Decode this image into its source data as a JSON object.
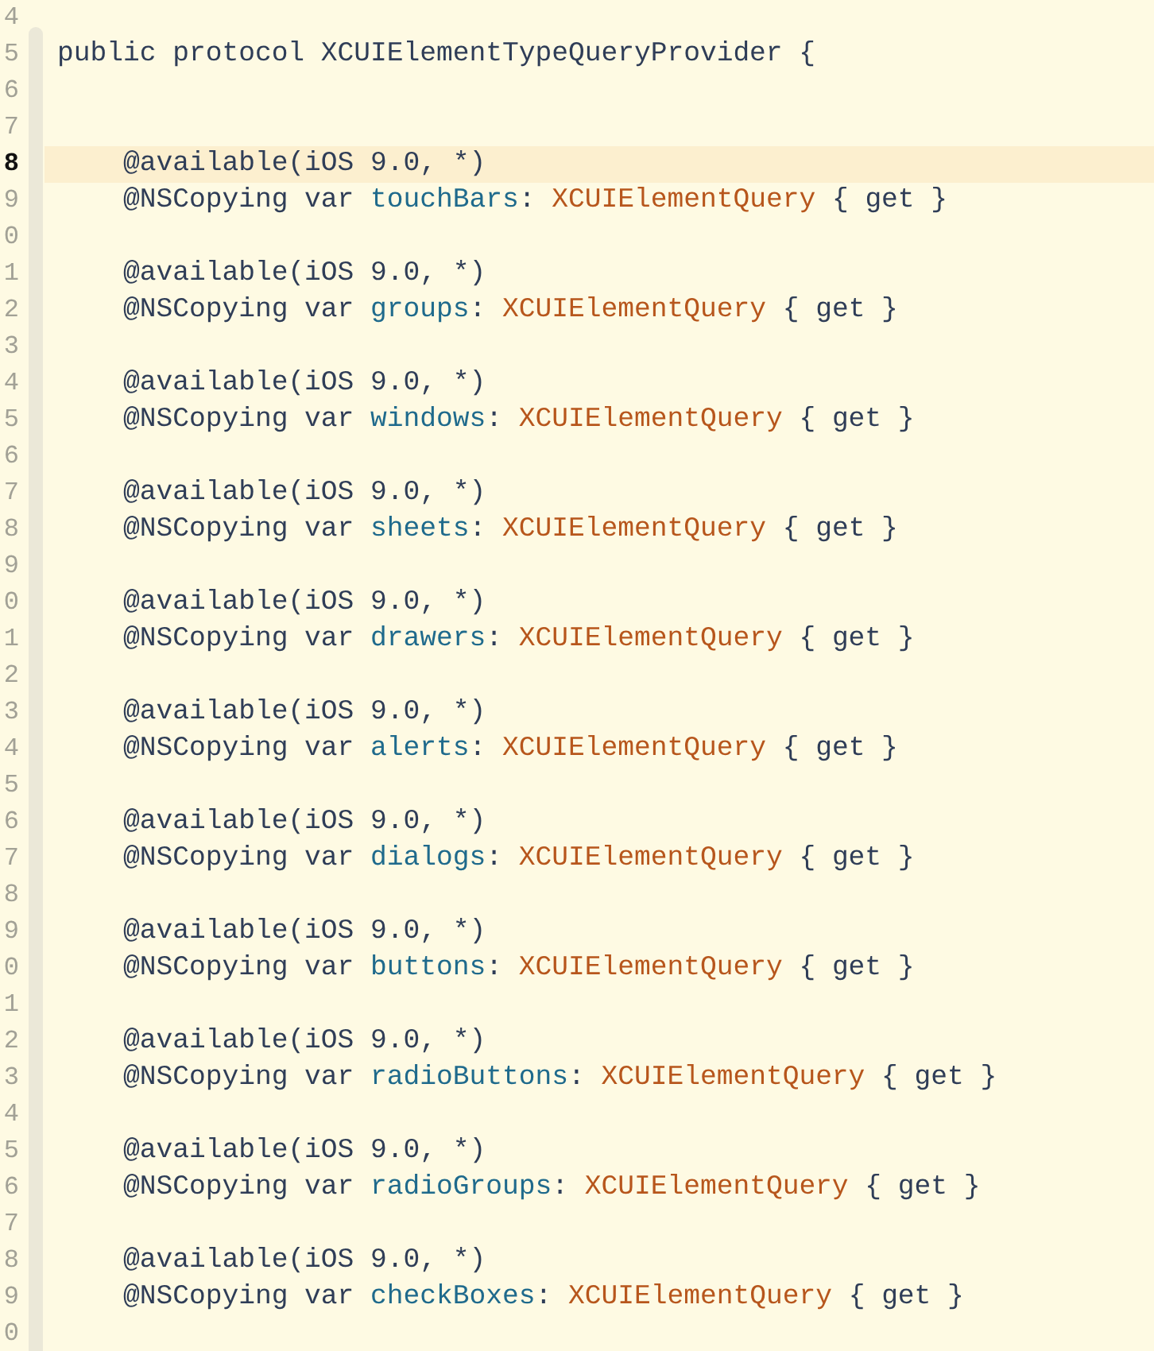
{
  "editor": {
    "lines": [
      {
        "number": "4",
        "highlighted": false
      },
      {
        "number": "5",
        "highlighted": false,
        "tokens": [
          {
            "kind": "plain",
            "text": "public protocol XCUIElementTypeQueryProvider {"
          }
        ]
      },
      {
        "number": "6",
        "highlighted": false
      },
      {
        "number": "7",
        "highlighted": false
      },
      {
        "number": "8",
        "highlighted": true,
        "tokens": [
          {
            "kind": "plain",
            "text": "    @available(iOS 9.0, *)"
          }
        ]
      },
      {
        "number": "9",
        "highlighted": false,
        "tokens": [
          {
            "kind": "plain",
            "text": "    @NSCopying var "
          },
          {
            "kind": "name",
            "text": "touchBars"
          },
          {
            "kind": "plain",
            "text": ": "
          },
          {
            "kind": "type",
            "text": "XCUIElementQuery"
          },
          {
            "kind": "plain",
            "text": " { get }"
          }
        ]
      },
      {
        "number": "0",
        "highlighted": false
      },
      {
        "number": "1",
        "highlighted": false,
        "tokens": [
          {
            "kind": "plain",
            "text": "    @available(iOS 9.0, *)"
          }
        ]
      },
      {
        "number": "2",
        "highlighted": false,
        "tokens": [
          {
            "kind": "plain",
            "text": "    @NSCopying var "
          },
          {
            "kind": "name",
            "text": "groups"
          },
          {
            "kind": "plain",
            "text": ": "
          },
          {
            "kind": "type",
            "text": "XCUIElementQuery"
          },
          {
            "kind": "plain",
            "text": " { get }"
          }
        ]
      },
      {
        "number": "3",
        "highlighted": false
      },
      {
        "number": "4",
        "highlighted": false,
        "tokens": [
          {
            "kind": "plain",
            "text": "    @available(iOS 9.0, *)"
          }
        ]
      },
      {
        "number": "5",
        "highlighted": false,
        "tokens": [
          {
            "kind": "plain",
            "text": "    @NSCopying var "
          },
          {
            "kind": "name",
            "text": "windows"
          },
          {
            "kind": "plain",
            "text": ": "
          },
          {
            "kind": "type",
            "text": "XCUIElementQuery"
          },
          {
            "kind": "plain",
            "text": " { get }"
          }
        ]
      },
      {
        "number": "6",
        "highlighted": false
      },
      {
        "number": "7",
        "highlighted": false,
        "tokens": [
          {
            "kind": "plain",
            "text": "    @available(iOS 9.0, *)"
          }
        ]
      },
      {
        "number": "8",
        "highlighted": false,
        "tokens": [
          {
            "kind": "plain",
            "text": "    @NSCopying var "
          },
          {
            "kind": "name",
            "text": "sheets"
          },
          {
            "kind": "plain",
            "text": ": "
          },
          {
            "kind": "type",
            "text": "XCUIElementQuery"
          },
          {
            "kind": "plain",
            "text": " { get }"
          }
        ]
      },
      {
        "number": "9",
        "highlighted": false
      },
      {
        "number": "0",
        "highlighted": false,
        "tokens": [
          {
            "kind": "plain",
            "text": "    @available(iOS 9.0, *)"
          }
        ]
      },
      {
        "number": "1",
        "highlighted": false,
        "tokens": [
          {
            "kind": "plain",
            "text": "    @NSCopying var "
          },
          {
            "kind": "name",
            "text": "drawers"
          },
          {
            "kind": "plain",
            "text": ": "
          },
          {
            "kind": "type",
            "text": "XCUIElementQuery"
          },
          {
            "kind": "plain",
            "text": " { get }"
          }
        ]
      },
      {
        "number": "2",
        "highlighted": false
      },
      {
        "number": "3",
        "highlighted": false,
        "tokens": [
          {
            "kind": "plain",
            "text": "    @available(iOS 9.0, *)"
          }
        ]
      },
      {
        "number": "4",
        "highlighted": false,
        "tokens": [
          {
            "kind": "plain",
            "text": "    @NSCopying var "
          },
          {
            "kind": "name",
            "text": "alerts"
          },
          {
            "kind": "plain",
            "text": ": "
          },
          {
            "kind": "type",
            "text": "XCUIElementQuery"
          },
          {
            "kind": "plain",
            "text": " { get }"
          }
        ]
      },
      {
        "number": "5",
        "highlighted": false
      },
      {
        "number": "6",
        "highlighted": false,
        "tokens": [
          {
            "kind": "plain",
            "text": "    @available(iOS 9.0, *)"
          }
        ]
      },
      {
        "number": "7",
        "highlighted": false,
        "tokens": [
          {
            "kind": "plain",
            "text": "    @NSCopying var "
          },
          {
            "kind": "name",
            "text": "dialogs"
          },
          {
            "kind": "plain",
            "text": ": "
          },
          {
            "kind": "type",
            "text": "XCUIElementQuery"
          },
          {
            "kind": "plain",
            "text": " { get }"
          }
        ]
      },
      {
        "number": "8",
        "highlighted": false
      },
      {
        "number": "9",
        "highlighted": false,
        "tokens": [
          {
            "kind": "plain",
            "text": "    @available(iOS 9.0, *)"
          }
        ]
      },
      {
        "number": "0",
        "highlighted": false,
        "tokens": [
          {
            "kind": "plain",
            "text": "    @NSCopying var "
          },
          {
            "kind": "name",
            "text": "buttons"
          },
          {
            "kind": "plain",
            "text": ": "
          },
          {
            "kind": "type",
            "text": "XCUIElementQuery"
          },
          {
            "kind": "plain",
            "text": " { get }"
          }
        ]
      },
      {
        "number": "1",
        "highlighted": false
      },
      {
        "number": "2",
        "highlighted": false,
        "tokens": [
          {
            "kind": "plain",
            "text": "    @available(iOS 9.0, *)"
          }
        ]
      },
      {
        "number": "3",
        "highlighted": false,
        "tokens": [
          {
            "kind": "plain",
            "text": "    @NSCopying var "
          },
          {
            "kind": "name",
            "text": "radioButtons"
          },
          {
            "kind": "plain",
            "text": ": "
          },
          {
            "kind": "type",
            "text": "XCUIElementQuery"
          },
          {
            "kind": "plain",
            "text": " { get }"
          }
        ]
      },
      {
        "number": "4",
        "highlighted": false
      },
      {
        "number": "5",
        "highlighted": false,
        "tokens": [
          {
            "kind": "plain",
            "text": "    @available(iOS 9.0, *)"
          }
        ]
      },
      {
        "number": "6",
        "highlighted": false,
        "tokens": [
          {
            "kind": "plain",
            "text": "    @NSCopying var "
          },
          {
            "kind": "name",
            "text": "radioGroups"
          },
          {
            "kind": "plain",
            "text": ": "
          },
          {
            "kind": "type",
            "text": "XCUIElementQuery"
          },
          {
            "kind": "plain",
            "text": " { get }"
          }
        ]
      },
      {
        "number": "7",
        "highlighted": false
      },
      {
        "number": "8",
        "highlighted": false,
        "tokens": [
          {
            "kind": "plain",
            "text": "    @available(iOS 9.0, *)"
          }
        ]
      },
      {
        "number": "9",
        "highlighted": false,
        "tokens": [
          {
            "kind": "plain",
            "text": "    @NSCopying var "
          },
          {
            "kind": "name",
            "text": "checkBoxes"
          },
          {
            "kind": "plain",
            "text": ": "
          },
          {
            "kind": "type",
            "text": "XCUIElementQuery"
          },
          {
            "kind": "plain",
            "text": " { get }"
          }
        ]
      },
      {
        "number": "0",
        "highlighted": false
      }
    ]
  }
}
